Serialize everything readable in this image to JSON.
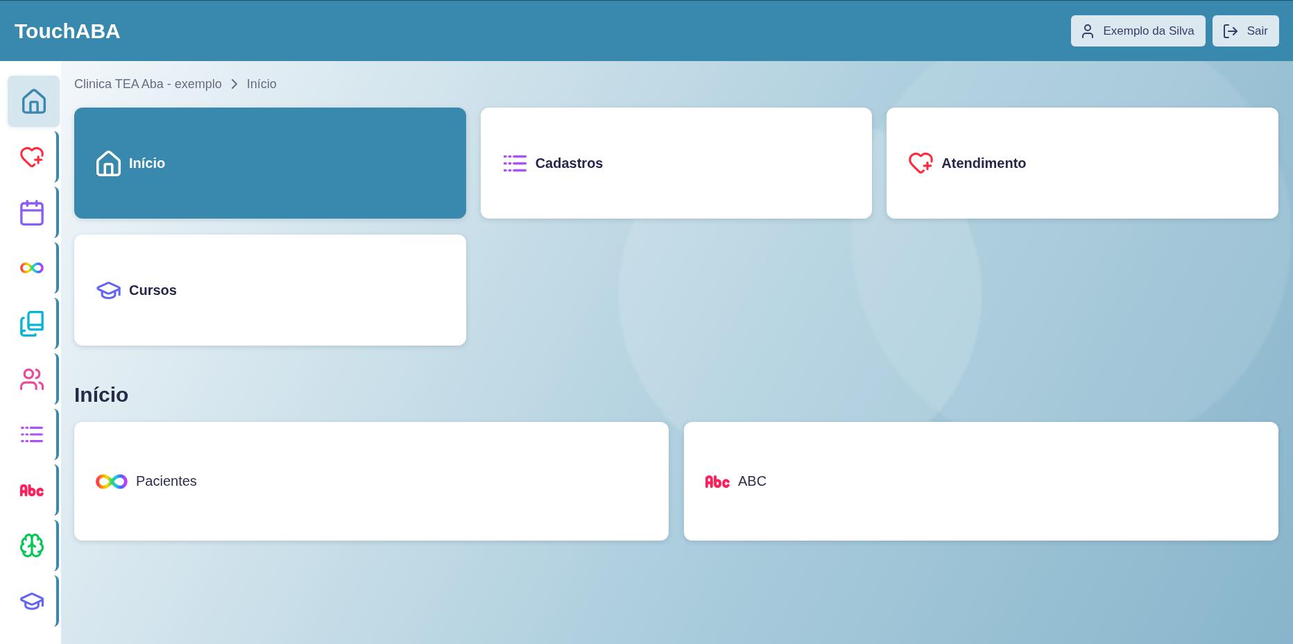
{
  "header": {
    "title": "TouchABA",
    "user_button": {
      "label": "Exemplo da Silva"
    },
    "logout_button": {
      "label": "Sair"
    }
  },
  "sidebar": {
    "items": [
      {
        "kind": "home",
        "selected": true
      },
      {
        "kind": "heart",
        "selected": false
      },
      {
        "kind": "calendar",
        "selected": false
      },
      {
        "kind": "infinity",
        "selected": false
      },
      {
        "kind": "books",
        "selected": false
      },
      {
        "kind": "users",
        "selected": false
      },
      {
        "kind": "list",
        "selected": false
      },
      {
        "kind": "abc",
        "selected": false
      },
      {
        "kind": "brain",
        "selected": false
      },
      {
        "kind": "graduation",
        "selected": false
      }
    ]
  },
  "breadcrumb": [
    {
      "label": "Clinica TEA Aba - exemplo"
    },
    {
      "label": "Início"
    }
  ],
  "modules": [
    {
      "label": "Início",
      "kind": "home",
      "selected": true
    },
    {
      "label": "Cadastros",
      "kind": "list",
      "selected": false
    },
    {
      "label": "Atendimento",
      "kind": "heart",
      "selected": false
    },
    {
      "label": "Cursos",
      "kind": "graduation",
      "selected": false
    }
  ],
  "section": {
    "title": "Início",
    "shortcuts": [
      {
        "label": "Pacientes",
        "kind": "infinity"
      },
      {
        "label": "ABC",
        "kind": "abc"
      }
    ]
  }
}
